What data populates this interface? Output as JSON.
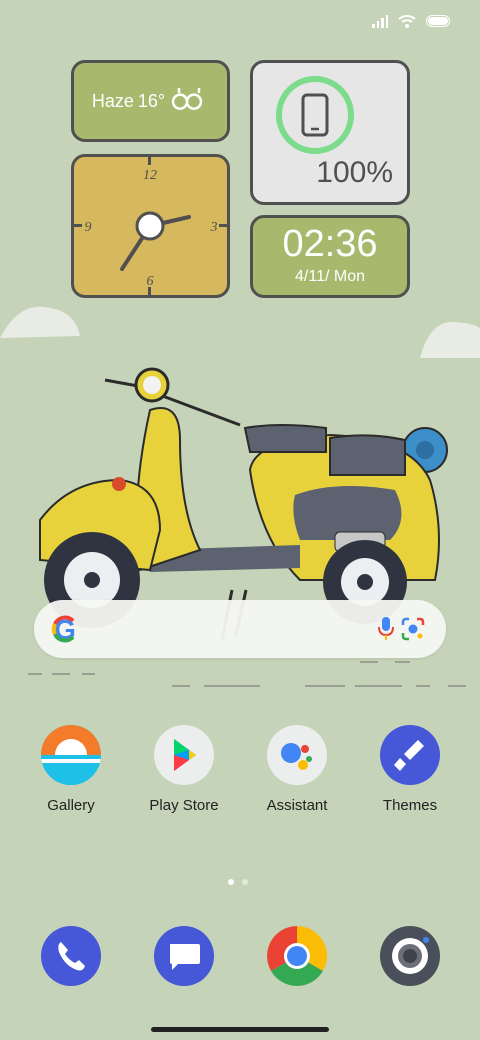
{
  "weather": {
    "condition": "Haze",
    "temperature": "16°"
  },
  "clock": {
    "num_12": "12",
    "num_3": "3",
    "num_6": "6",
    "num_9": "9"
  },
  "battery": {
    "percent": "100%"
  },
  "time": {
    "value": "02:36",
    "date": "4/11/ Mon"
  },
  "search": {
    "logo_letter": "G"
  },
  "apps": [
    {
      "label": "Gallery"
    },
    {
      "label": "Play Store"
    },
    {
      "label": "Assistant"
    },
    {
      "label": "Themes"
    }
  ],
  "dock": [
    {
      "name": "phone"
    },
    {
      "name": "messages"
    },
    {
      "name": "chrome"
    },
    {
      "name": "camera"
    }
  ],
  "pager": {
    "current": 1,
    "total": 2
  },
  "colors": {
    "background": "#c5d4b8",
    "widget_green": "#a8b96e",
    "widget_yellow": "#d6b85e",
    "widget_border": "#505050",
    "battery_ring": "#7ddc8c"
  }
}
